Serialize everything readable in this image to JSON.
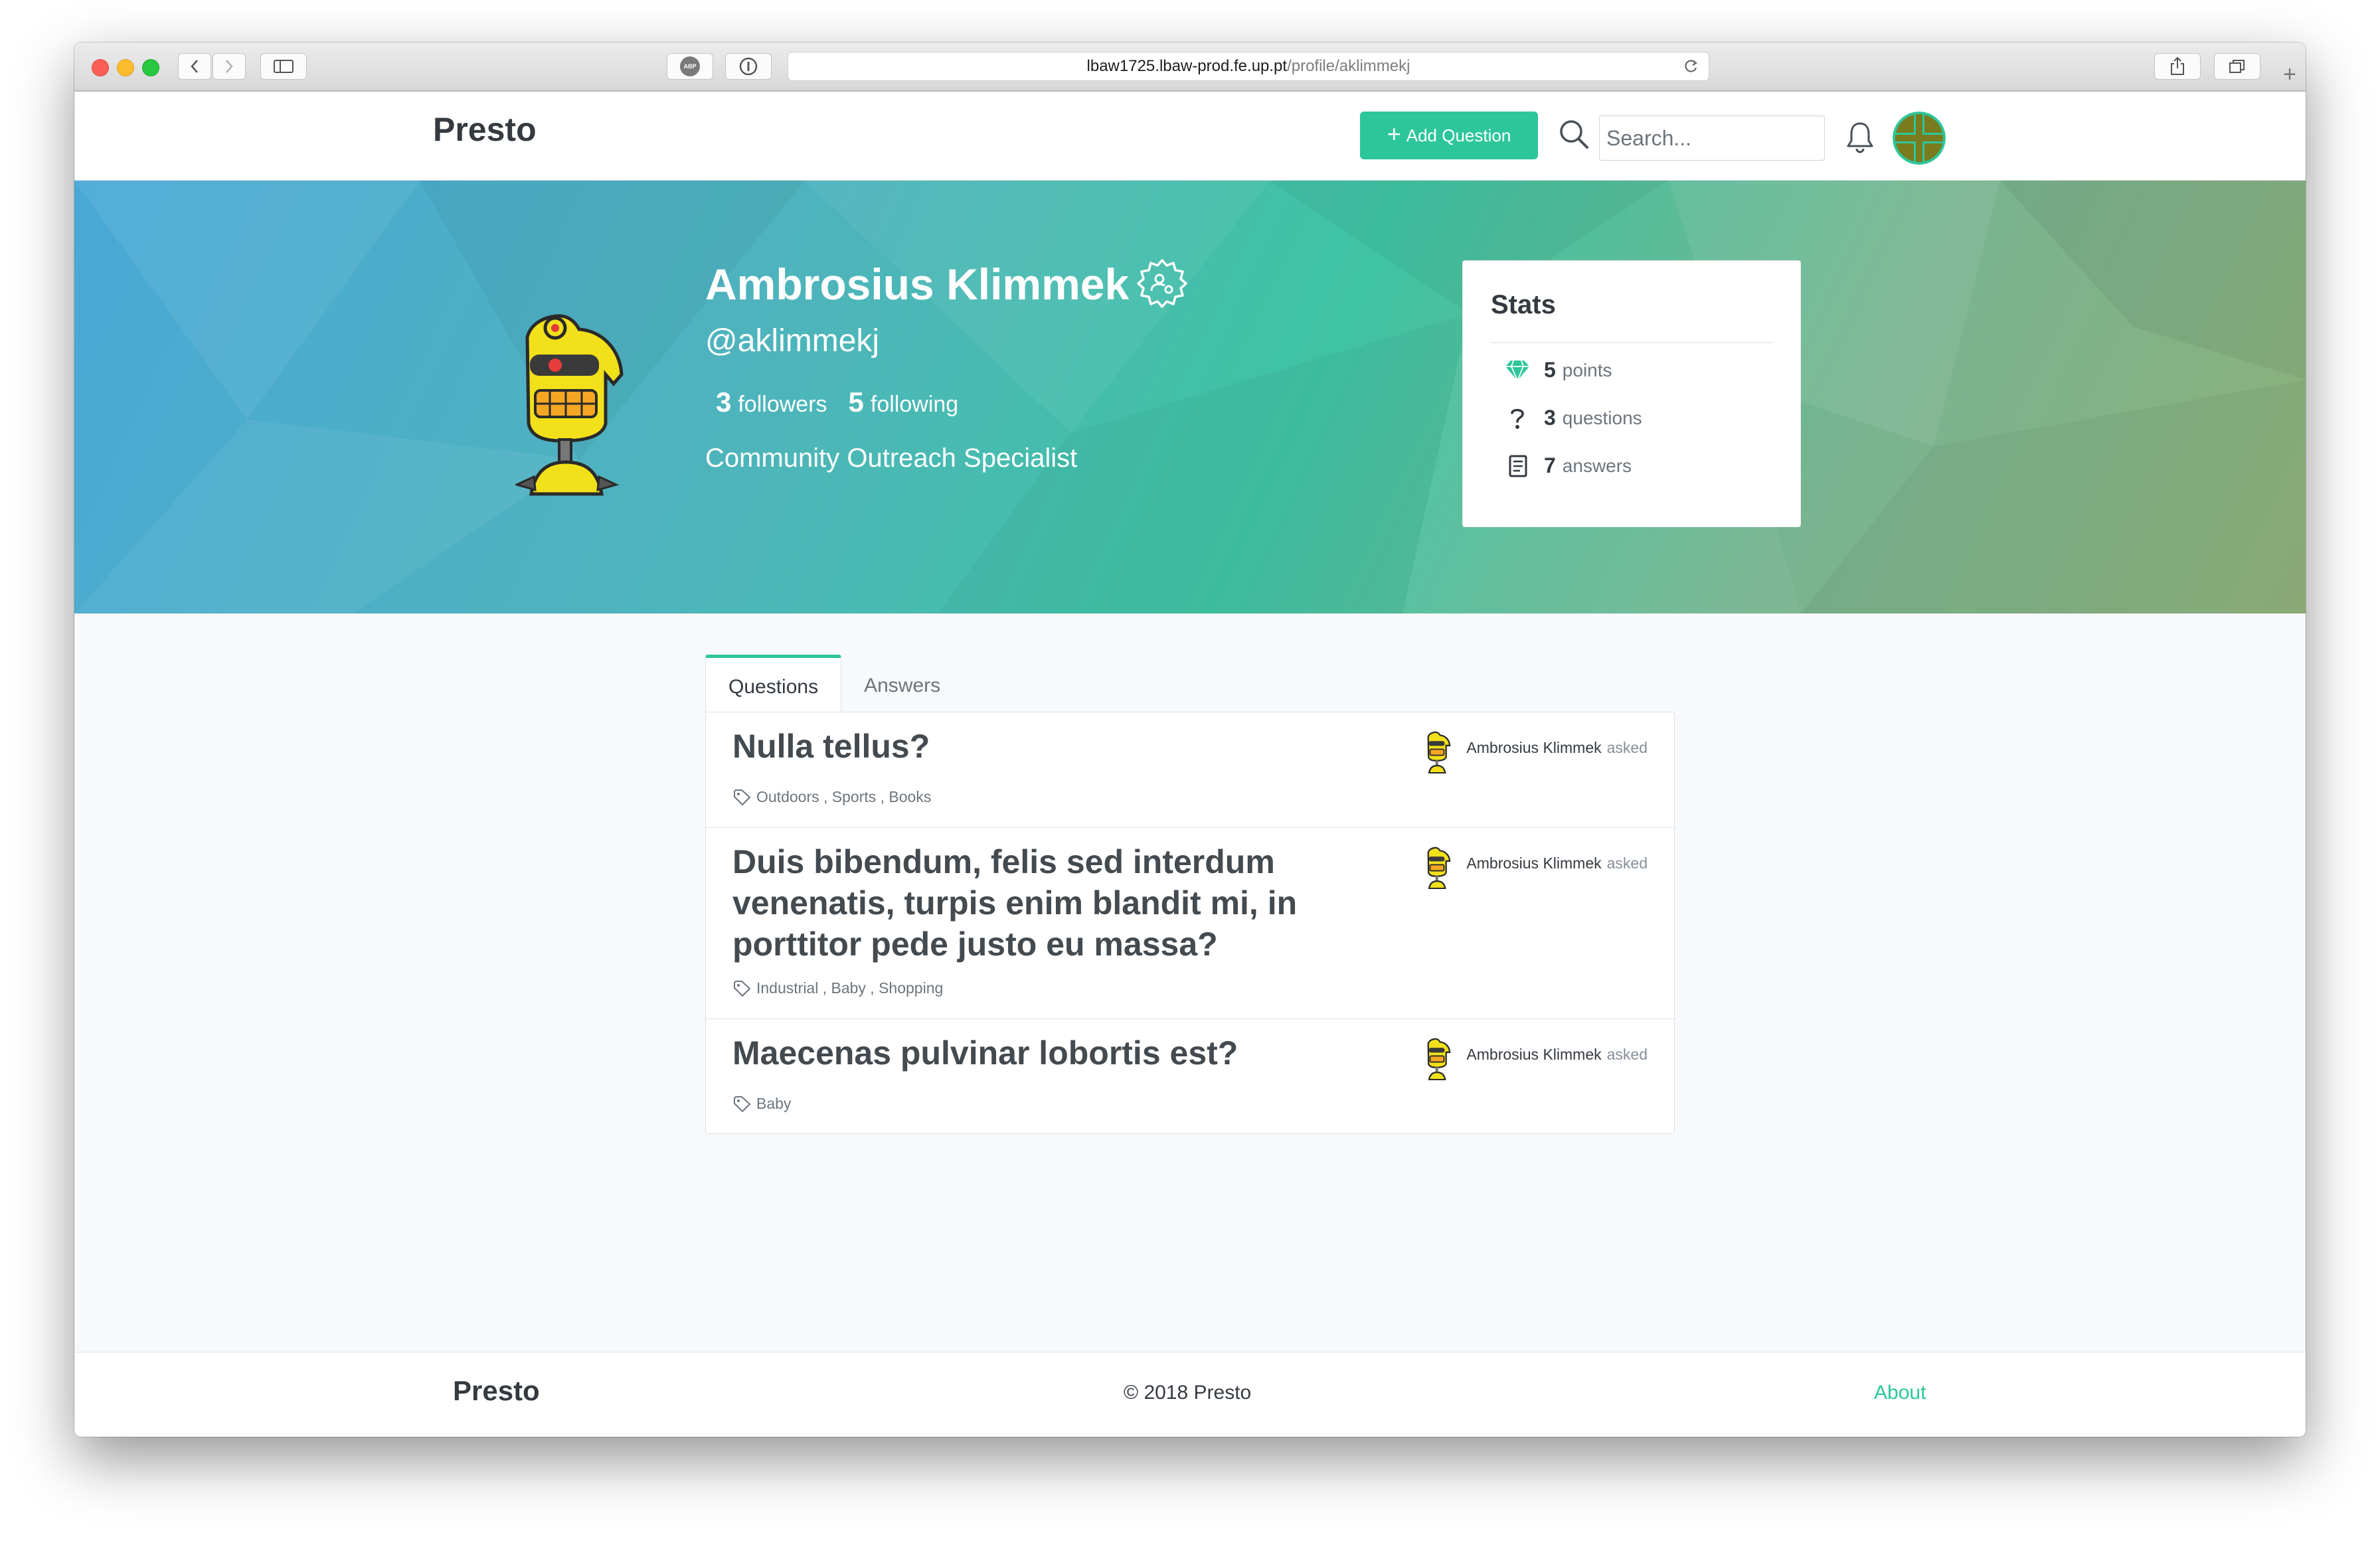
{
  "browser": {
    "url_host": "lbaw1725.lbaw-prod.fe.up.pt",
    "url_path": "/profile/aklimmekj",
    "adblock_label": "ABP"
  },
  "navbar": {
    "brand": "Presto",
    "add_question_label": "Add Question",
    "search_placeholder": "Search..."
  },
  "profile": {
    "name": "Ambrosius Klimmek",
    "handle": "@aklimmekj",
    "followers_count": "3",
    "followers_label": "followers",
    "following_count": "5",
    "following_label": "following",
    "title": "Community Outreach Specialist"
  },
  "stats": {
    "heading": "Stats",
    "items": [
      {
        "value": "5",
        "label": "points",
        "icon": "diamond-icon"
      },
      {
        "value": "3",
        "label": "questions",
        "icon": "question-icon"
      },
      {
        "value": "7",
        "label": "answers",
        "icon": "answers-icon"
      }
    ]
  },
  "tabs": [
    {
      "label": "Questions",
      "active": true
    },
    {
      "label": "Answers",
      "active": false
    }
  ],
  "questions": [
    {
      "title": "Nulla tellus?",
      "tags": "Outdoors , Sports , Books",
      "author": "Ambrosius Klimmek",
      "action": "asked"
    },
    {
      "title": "Duis bibendum, felis sed interdum venenatis, turpis enim blandit mi, in porttitor pede justo eu massa?",
      "tags": "Industrial , Baby , Shopping",
      "author": "Ambrosius Klimmek",
      "action": "asked"
    },
    {
      "title": "Maecenas pulvinar lobortis est?",
      "tags": "Baby",
      "author": "Ambrosius Klimmek",
      "action": "asked"
    }
  ],
  "footer": {
    "brand": "Presto",
    "copyright": "© 2018 Presto",
    "about": "About"
  },
  "colors": {
    "accent": "#2dc69a",
    "text_dark": "#343a40",
    "text_muted": "#6c757d"
  }
}
